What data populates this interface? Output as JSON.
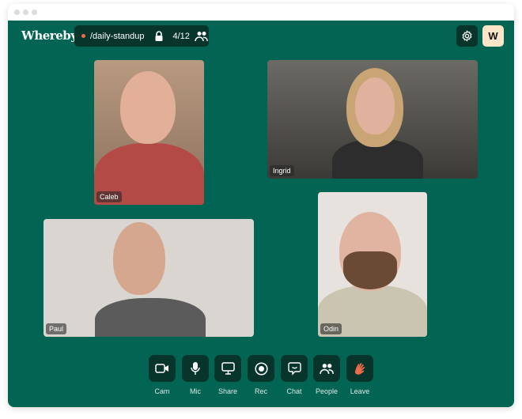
{
  "header": {
    "logo": "Whereby",
    "room": "/daily-standup",
    "count": "4/12",
    "avatar": "W"
  },
  "participants": [
    {
      "name": "Caleb"
    },
    {
      "name": "Ingrid"
    },
    {
      "name": "Paul"
    },
    {
      "name": "Odin"
    }
  ],
  "controls": [
    {
      "label": "Cam",
      "icon": "camera-icon"
    },
    {
      "label": "Mic",
      "icon": "microphone-icon"
    },
    {
      "label": "Share",
      "icon": "screen-share-icon"
    },
    {
      "label": "Rec",
      "icon": "record-icon"
    },
    {
      "label": "Chat",
      "icon": "chat-icon"
    },
    {
      "label": "People",
      "icon": "people-icon"
    },
    {
      "label": "Leave",
      "icon": "wave-hand-icon"
    }
  ],
  "colors": {
    "background": "#026452",
    "control": "#07352c",
    "accent": "#ef6c4a",
    "avatar": "#fbe5c8"
  }
}
